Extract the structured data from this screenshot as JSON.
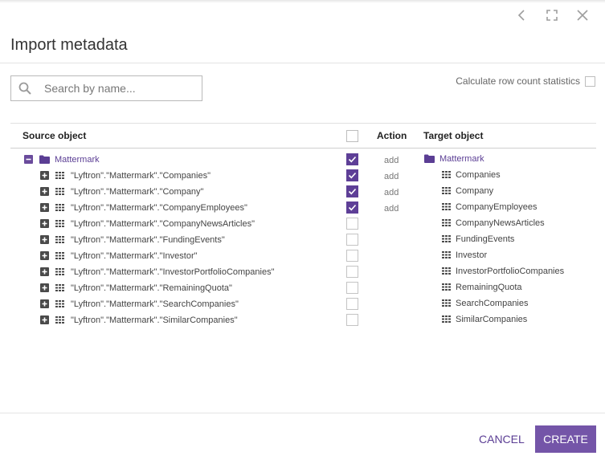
{
  "dialog": {
    "title": "Import metadata",
    "controls": [
      "chevron-left-icon",
      "fullscreen-icon",
      "close-icon"
    ]
  },
  "search": {
    "placeholder": "Search by name...",
    "value": ""
  },
  "calc_stats": {
    "label": "Calculate row count statistics",
    "checked": false
  },
  "table": {
    "headers": {
      "source": "Source object",
      "action": "Action",
      "target": "Target object"
    },
    "root": {
      "source": "Mattermark",
      "checked": true,
      "action": "add",
      "target": "Mattermark"
    },
    "rows": [
      {
        "source": "\"Lyftron\".\"Mattermark\".\"Companies\"",
        "checked": true,
        "action": "add",
        "target": "Companies"
      },
      {
        "source": "\"Lyftron\".\"Mattermark\".\"Company\"",
        "checked": true,
        "action": "add",
        "target": "Company"
      },
      {
        "source": "\"Lyftron\".\"Mattermark\".\"CompanyEmployees\"",
        "checked": true,
        "action": "add",
        "target": "CompanyEmployees"
      },
      {
        "source": "\"Lyftron\".\"Mattermark\".\"CompanyNewsArticles\"",
        "checked": false,
        "action": "",
        "target": "CompanyNewsArticles"
      },
      {
        "source": "\"Lyftron\".\"Mattermark\".\"FundingEvents\"",
        "checked": false,
        "action": "",
        "target": "FundingEvents"
      },
      {
        "source": "\"Lyftron\".\"Mattermark\".\"Investor\"",
        "checked": false,
        "action": "",
        "target": "Investor"
      },
      {
        "source": "\"Lyftron\".\"Mattermark\".\"InvestorPortfolioCompanies\"",
        "checked": false,
        "action": "",
        "target": "InvestorPortfolioCompanies"
      },
      {
        "source": "\"Lyftron\".\"Mattermark\".\"RemainingQuota\"",
        "checked": false,
        "action": "",
        "target": "RemainingQuota"
      },
      {
        "source": "\"Lyftron\".\"Mattermark\".\"SearchCompanies\"",
        "checked": false,
        "action": "",
        "target": "SearchCompanies"
      },
      {
        "source": "\"Lyftron\".\"Mattermark\".\"SimilarCompanies\"",
        "checked": false,
        "action": "",
        "target": "SimilarCompanies"
      }
    ]
  },
  "footer": {
    "cancel_label": "CANCEL",
    "create_label": "CREATE"
  },
  "colors": {
    "accent": "#5e3f97",
    "button": "#7455a8"
  }
}
